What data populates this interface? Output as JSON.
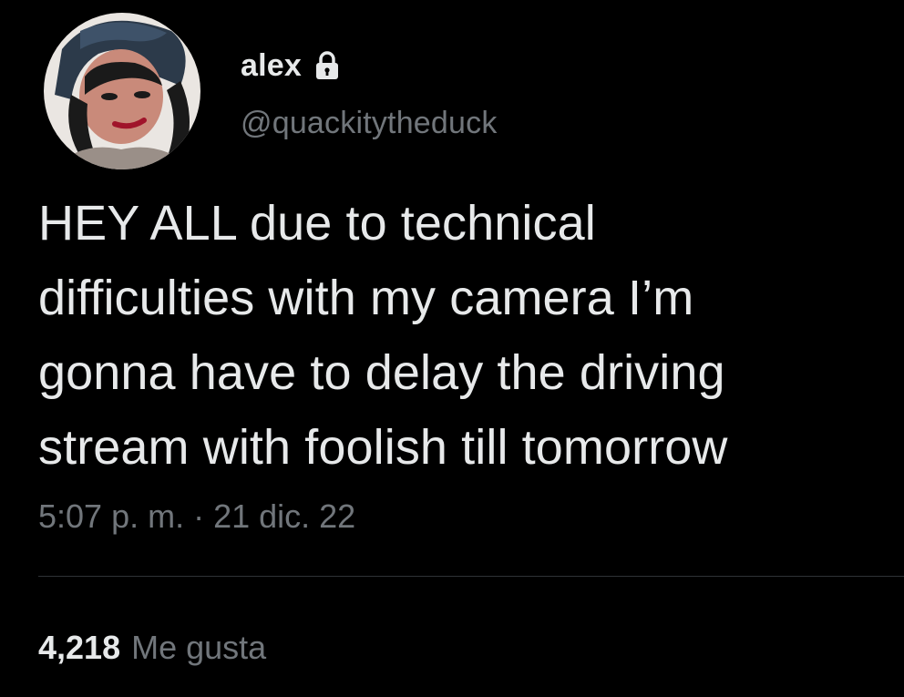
{
  "user": {
    "display_name": "alex",
    "handle": "@quackitytheduck",
    "verified_icon": "lock-icon",
    "avatar_icon": "profile-avatar"
  },
  "tweet": {
    "lines": [
      "HEY ALL due to technical",
      "difficulties with my camera I’m",
      "gonna have to delay the driving",
      "stream with foolish till tomorrow"
    ],
    "timestamp": "5:07 p. m. · 21 dic. 22"
  },
  "stats": {
    "likes_count": "4,218",
    "likes_label": "Me gusta"
  },
  "colors": {
    "background": "#000000",
    "primary_text": "#e7e9ea",
    "secondary_text": "#71767b",
    "divider": "#2f3336"
  }
}
